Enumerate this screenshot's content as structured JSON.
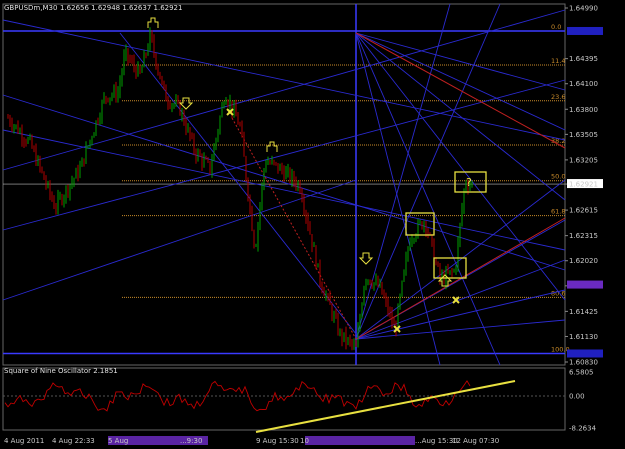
{
  "window": {
    "symbol_title": "GBPUSDm,M30",
    "ohlc": "1.62656 1.62948 1.62637 1.62921"
  },
  "colors": {
    "background": "#000000",
    "grid": "#2a2a2a",
    "candle_up": "#00a000",
    "candle_down": "#b00000",
    "fib": "#c88a2a",
    "gann_blue": "#2a2ad0",
    "red_line": "#c02020",
    "oscillator": "#c00000",
    "trendline": "#e8e040",
    "marker": "#e8e040",
    "current_price_tag": "#ffffff",
    "blue_price_tag": "#2020c0",
    "purple_price_tag": "#6a2ac0"
  },
  "price_axis": {
    "labels": [
      "1.64990",
      "1.64395",
      "1.64100",
      "1.63800",
      "1.63505",
      "1.63205",
      "1.62921",
      "1.62615",
      "1.62315",
      "1.62020",
      "1.61725",
      "1.61425",
      "1.61130",
      "1.60830"
    ],
    "current_price": "1.62921"
  },
  "fib_levels": [
    {
      "label": "0.0",
      "price": 1.6472
    },
    {
      "label": "11.4",
      "price": 1.6432
    },
    {
      "label": "23.6",
      "price": 1.639
    },
    {
      "label": "38.2",
      "price": 1.6338
    },
    {
      "label": "50.0",
      "price": 1.6296
    },
    {
      "label": "61.8",
      "price": 1.6255
    },
    {
      "label": "80.6",
      "price": 1.6159
    },
    {
      "label": "100.0",
      "price": 1.6093
    }
  ],
  "oscillator": {
    "title": "Square of Nine Oscillator 2.1851",
    "labels": [
      "6.5805",
      "0.00",
      "-8.2634"
    ]
  },
  "time_axis": {
    "labels": [
      "4 Aug 2011",
      "4 Aug 22:33",
      "5 Aug",
      "...9:30",
      "9 Aug 15:30",
      "10",
      "...Aug 15:30",
      "12 Aug 07:30"
    ]
  },
  "annotations": {
    "question_mark": "?"
  }
}
